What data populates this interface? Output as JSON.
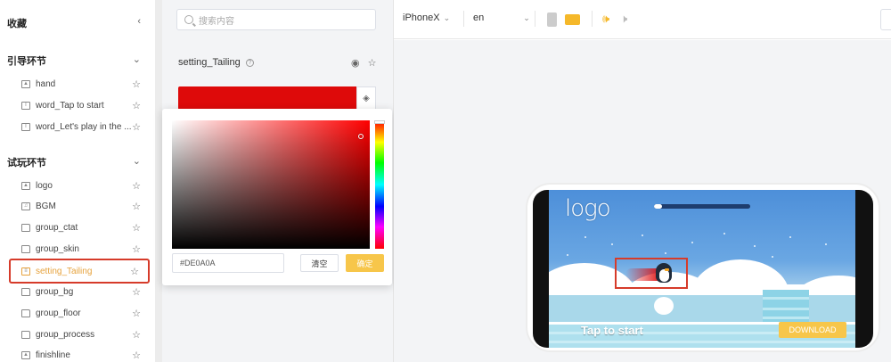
{
  "sidebar": {
    "favorites_title": "收藏",
    "sections": [
      {
        "title": "引导环节",
        "items": [
          {
            "label": "hand",
            "icon": "image-icon"
          },
          {
            "label": "word_Tap to start",
            "icon": "text-icon"
          },
          {
            "label": "word_Let's play in the ...",
            "icon": "text-icon"
          }
        ]
      },
      {
        "title": "试玩环节",
        "items": [
          {
            "label": "logo",
            "icon": "image-icon"
          },
          {
            "label": "BGM",
            "icon": "music-icon"
          },
          {
            "label": "group_ctat",
            "icon": "folder-icon"
          },
          {
            "label": "group_skin",
            "icon": "folder-icon"
          },
          {
            "label": "setting_Tailing",
            "icon": "setting-icon",
            "selected": true
          },
          {
            "label": "group_bg",
            "icon": "folder-icon"
          },
          {
            "label": "group_floor",
            "icon": "folder-icon"
          },
          {
            "label": "group_process",
            "icon": "folder-icon"
          },
          {
            "label": "finishline",
            "icon": "image-icon"
          }
        ]
      }
    ]
  },
  "search": {
    "placeholder": "搜索内容"
  },
  "property": {
    "title": "setting_Tailing",
    "color_value": "#DE0A0A"
  },
  "color_picker": {
    "hex_value": "#DE0A0A",
    "clear_label": "清空",
    "confirm_label": "确定"
  },
  "toolbar": {
    "device": "iPhoneX",
    "language": "en",
    "orientation": "landscape",
    "sound": "on"
  },
  "game": {
    "logo_text": "logo",
    "progress": 0.08,
    "cta_text": "Tap to start",
    "download_label": "DOWNLOAD"
  },
  "colors": {
    "accent": "#f5b82a",
    "highlight": "#d63b2a",
    "tailing": "#DE0A0A"
  }
}
